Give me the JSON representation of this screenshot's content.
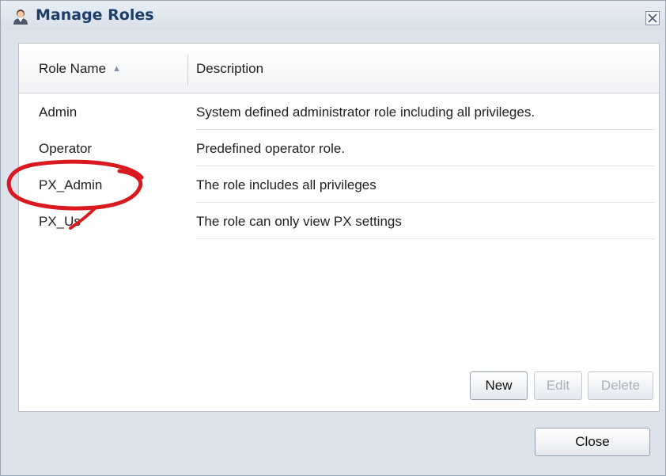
{
  "window": {
    "title": "Manage Roles",
    "title_icon": "user-icon",
    "close_icon": "close-icon"
  },
  "table": {
    "columns": [
      {
        "label": "Role Name",
        "sort": "ascending"
      },
      {
        "label": "Description"
      }
    ],
    "rows": [
      {
        "name": "Admin",
        "description": "System defined administrator role including all privileges."
      },
      {
        "name": "Operator",
        "description": "Predefined operator role."
      },
      {
        "name": "PX_Admin",
        "description": "The role includes all privileges"
      },
      {
        "name": "PX_Us",
        "description": "The role can only view PX settings"
      }
    ]
  },
  "buttons": {
    "new": "New",
    "edit": "Edit",
    "delete": "Delete",
    "close": "Close"
  },
  "colors": {
    "title_text": "#1b3e6b",
    "annotation": "#d8191f"
  }
}
